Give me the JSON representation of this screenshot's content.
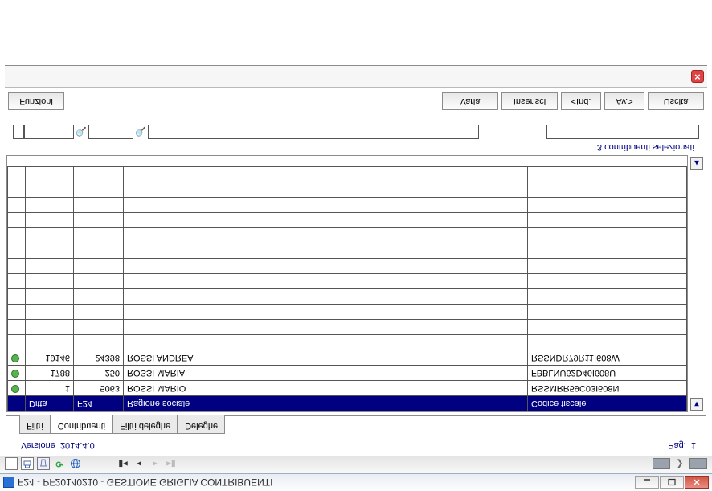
{
  "window": {
    "title": "F24 - PF20140210 - GESTIONE GRIGLIA CONTRIBUENTI"
  },
  "toolbar": {
    "funzioni": "Funzioni",
    "varia": "Varia",
    "inserisci": "Inserisci",
    "ind": "<Ind.",
    "av": "Av.>",
    "uscita": "Uscita"
  },
  "filters": {
    "status_label": "3 contribuenti selezionati",
    "small1": "",
    "small2": "",
    "wide": "",
    "wide2": ""
  },
  "columns": {
    "c0": "",
    "ditta": "Ditta",
    "f24": "F24",
    "ragione": "Ragione sociale",
    "cf": "Codice fiscale"
  },
  "rows": [
    {
      "ditta": "1",
      "f24": "5063",
      "ragione": "ROSSI MARIO",
      "cf": "RSSMRR59C03I608N"
    },
    {
      "ditta": "1788",
      "f24": "250",
      "ragione": "ROSSI MARIA",
      "cf": "FBBLNU62D46I608U"
    },
    {
      "ditta": "19146",
      "f24": "24398",
      "ragione": "ROSSI ANDREA",
      "cf": "RSSNDR79R11I608W"
    }
  ],
  "bottom_tabs": {
    "filtri": "Filtri",
    "contribuenti": "Contribuenti",
    "filtri_deleghe": "Filtri deleghe",
    "deleghe": "Deleghe"
  },
  "footer": {
    "versione_label": "Versione",
    "versione_val": "2014.4.0",
    "page_label": "Pag.",
    "page_val": "1"
  }
}
